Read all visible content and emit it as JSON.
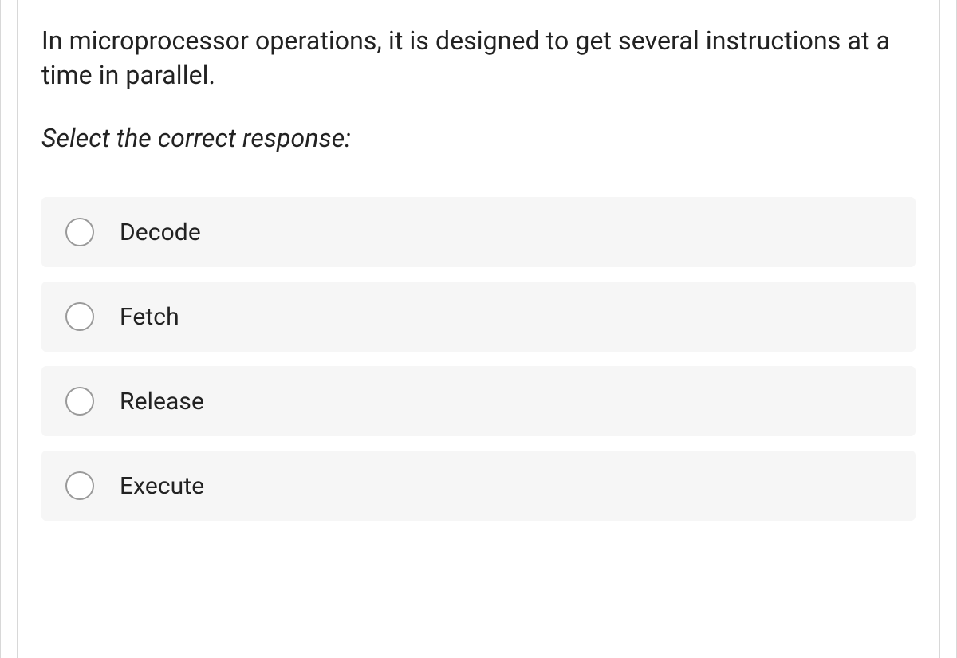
{
  "question": "In microprocessor operations, it is designed to get several instructions at a time in parallel.",
  "instruction": "Select the correct response:",
  "options": [
    {
      "label": "Decode"
    },
    {
      "label": "Fetch"
    },
    {
      "label": "Release"
    },
    {
      "label": "Execute"
    }
  ]
}
